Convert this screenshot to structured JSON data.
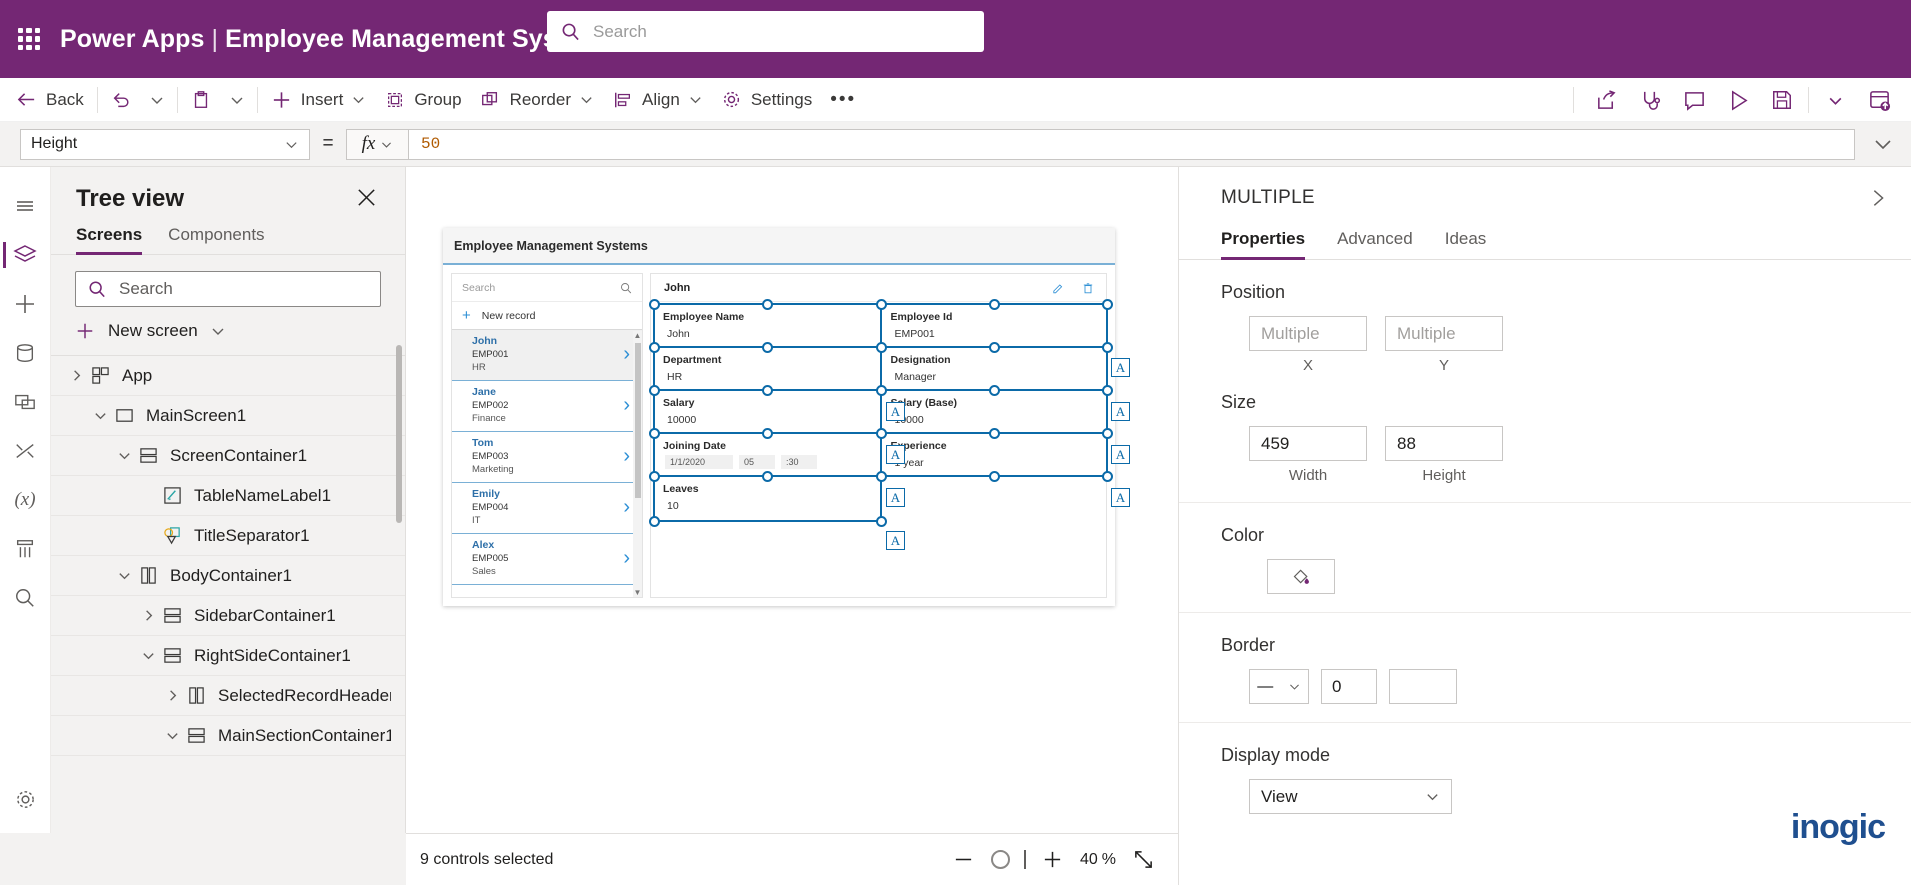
{
  "topbar": {
    "waffle_icon": "app-launcher-icon",
    "product": "Power Apps",
    "divider": "|",
    "app_name": "Employee Management System",
    "search_placeholder": "Search",
    "search_icon": "search-icon",
    "bg_color": "#742774"
  },
  "command_bar": {
    "back": "Back",
    "undo_icon": "undo-icon",
    "paste_icon": "paste-icon",
    "insert": "Insert",
    "group": "Group",
    "reorder": "Reorder",
    "align": "Align",
    "settings": "Settings",
    "overflow": "•••",
    "right_icons": [
      "share-icon",
      "app-checker-icon",
      "comments-icon",
      "preview-play-icon",
      "save-icon",
      "chevron-down-icon",
      "publish-icon"
    ]
  },
  "formula_bar": {
    "property": "Height",
    "equals": "=",
    "fx": "fx",
    "value": "50",
    "expand_icon": "chevron-down-icon"
  },
  "left_rail": [
    {
      "name": "menu-hamburger",
      "icon": "hamburger-icon"
    },
    {
      "name": "tree-view",
      "icon": "layers-icon",
      "active": true
    },
    {
      "name": "insert",
      "icon": "plus-icon"
    },
    {
      "name": "data",
      "icon": "database-icon"
    },
    {
      "name": "media",
      "icon": "media-icon"
    },
    {
      "name": "power-automate",
      "icon": "flow-icon"
    },
    {
      "name": "variables",
      "icon": "variables-icon"
    },
    {
      "name": "search-in-app",
      "icon": "app-search-icon"
    },
    {
      "name": "app-settings",
      "icon": "gear-icon"
    },
    {
      "name": "advanced-tools",
      "icon": "tools-icon"
    }
  ],
  "tree_view": {
    "title": "Tree view",
    "close_icon": "close-icon",
    "tabs": [
      {
        "label": "Screens",
        "active": true
      },
      {
        "label": "Components",
        "active": false
      }
    ],
    "search_placeholder": "Search",
    "search_icon": "search-icon",
    "new_screen": "New screen",
    "items": [
      {
        "label": "App",
        "indent": 0,
        "chevron": "collapsed",
        "icon": "app-icon"
      },
      {
        "label": "MainScreen1",
        "indent": 1,
        "chevron": "expanded",
        "icon": "screen-icon"
      },
      {
        "label": "ScreenContainer1",
        "indent": 2,
        "chevron": "expanded",
        "icon": "vertical-container-icon"
      },
      {
        "label": "TableNameLabel1",
        "indent": 3,
        "chevron": "none",
        "icon": "label-icon"
      },
      {
        "label": "TitleSeparator1",
        "indent": 3,
        "chevron": "none",
        "icon": "shapes-icon"
      },
      {
        "label": "BodyContainer1",
        "indent": 2,
        "chevron": "expanded",
        "icon": "horizontal-container-icon"
      },
      {
        "label": "SidebarContainer1",
        "indent": 3,
        "chevron": "collapsed",
        "icon": "vertical-container-icon"
      },
      {
        "label": "RightSideContainer1",
        "indent": 3,
        "chevron": "expanded",
        "icon": "vertical-container-icon"
      },
      {
        "label": "SelectedRecordHeaderContai",
        "indent": 4,
        "chevron": "collapsed",
        "icon": "horizontal-container-icon"
      },
      {
        "label": "MainSectionContainer1",
        "indent": 4,
        "chevron": "expanded",
        "icon": "vertical-container-icon"
      }
    ]
  },
  "canvas": {
    "app_title": "Employee Management Systems",
    "sidebar": {
      "search_placeholder": "Search",
      "search_icon": "search-icon",
      "new_record": "New record",
      "records": [
        {
          "name": "John",
          "id": "EMP001",
          "dept": "HR",
          "selected": true
        },
        {
          "name": "Jane",
          "id": "EMP002",
          "dept": "Finance",
          "selected": false
        },
        {
          "name": "Tom",
          "id": "EMP003",
          "dept": "Marketing",
          "selected": false
        },
        {
          "name": "Emily",
          "id": "EMP004",
          "dept": "IT",
          "selected": false
        },
        {
          "name": "Alex",
          "id": "EMP005",
          "dept": "Sales",
          "selected": false
        }
      ]
    },
    "record": {
      "header_name": "John",
      "edit_icon": "pencil-icon",
      "delete_icon": "trash-icon",
      "fields_left": [
        {
          "label": "Employee Name",
          "value": "John"
        },
        {
          "label": "Department",
          "value": "HR"
        },
        {
          "label": "Salary",
          "value": "10000"
        },
        {
          "label": "Joining Date",
          "value": "1/1/2020",
          "date_parts": [
            "1/1/2020",
            "05",
            ":30"
          ]
        },
        {
          "label": "Leaves",
          "value": "10"
        }
      ],
      "fields_right": [
        {
          "label": "Employee Id",
          "value": "EMP001"
        },
        {
          "label": "Designation",
          "value": "Manager"
        },
        {
          "label": "Salary (Base)",
          "value": "10000"
        },
        {
          "label": "Experience",
          "value": "1 year"
        }
      ]
    },
    "selection_color": "#0b6aa8"
  },
  "properties_panel": {
    "header": "MULTIPLE",
    "expand_icon": "chevron-right-icon",
    "tabs": [
      {
        "label": "Properties",
        "active": true
      },
      {
        "label": "Advanced",
        "active": false
      },
      {
        "label": "Ideas",
        "active": false
      }
    ],
    "position": {
      "label": "Position",
      "x_value": "Multiple",
      "y_value": "Multiple",
      "x_caption": "X",
      "y_caption": "Y"
    },
    "size": {
      "label": "Size",
      "width_value": "459",
      "height_value": "88",
      "width_caption": "Width",
      "height_caption": "Height"
    },
    "color": {
      "label": "Color",
      "icon": "fill-bucket-icon"
    },
    "border": {
      "label": "Border",
      "style": "—",
      "width": "0",
      "color_swatch": "#ffffff"
    },
    "display_mode": {
      "label": "Display mode",
      "value": "View"
    },
    "watermark": "inogic"
  },
  "status_bar": {
    "selection_count": "9 controls selected",
    "zoom_out_icon": "minus-icon",
    "zoom_in_icon": "plus-icon",
    "zoom_percent": "40",
    "percent_sign": "%",
    "fit_icon": "fit-screen-icon"
  }
}
